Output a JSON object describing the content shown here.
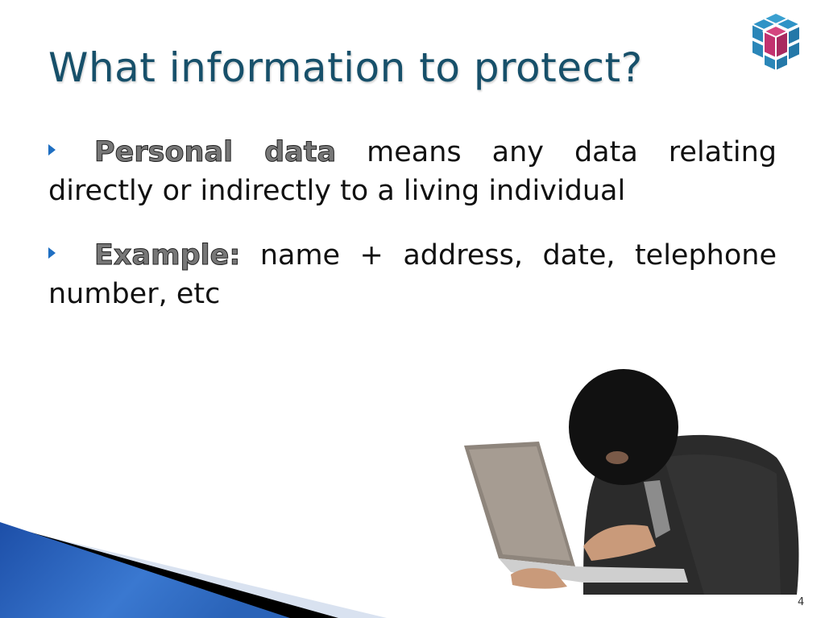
{
  "slide": {
    "title": "What information to protect?",
    "bullets": [
      {
        "lead": "Personal data",
        "text": " means any data relating directly or indirectly to a living individual"
      },
      {
        "lead": "Example:",
        "text": " name + address, date, telephone number, etc"
      }
    ],
    "page_number": "4",
    "logo_icon": "cube-logo-icon",
    "image_description": "masked-hacker-with-laptop",
    "colors": {
      "title": "#17506a",
      "bullet_arrow": "#1f6fc2",
      "band_blue": "#2a63b8",
      "cube_blue": "#2a8fc0",
      "cube_magenta": "#c2326f"
    }
  }
}
